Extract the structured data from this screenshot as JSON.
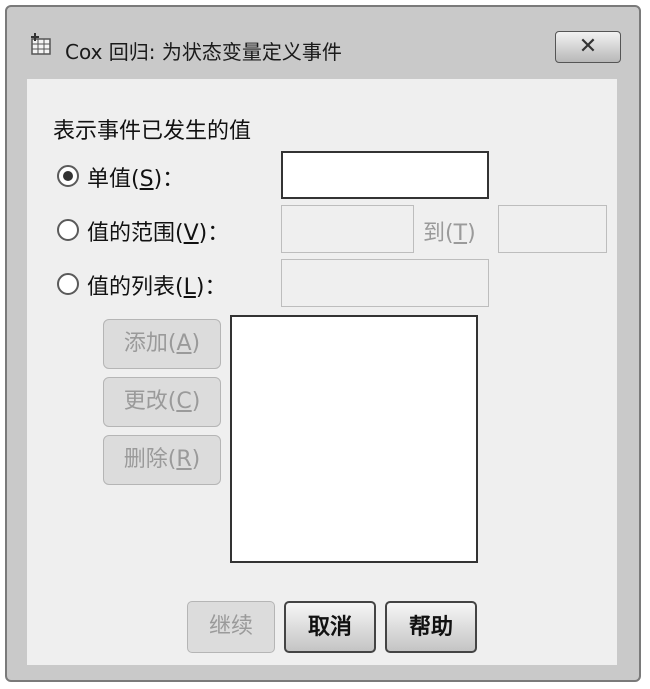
{
  "window": {
    "title": "Cox 回归: 为状态变量定义事件",
    "close_glyph": "✕",
    "app_icon": "data-table-icon"
  },
  "group_label": "表示事件已发生的值",
  "options": {
    "single": {
      "label": "单值",
      "mnemonic_open": "(",
      "mnemonic": "S",
      "mnemonic_close": ")",
      "colon": "：",
      "selected": true
    },
    "range": {
      "label": "值的范围",
      "mnemonic_open": "(",
      "mnemonic": "V",
      "mnemonic_close": ")",
      "colon": "：",
      "selected": false,
      "to_label": "到",
      "to_mnemonic_open": "(",
      "to_mnemonic": "T",
      "to_mnemonic_close": ")"
    },
    "list": {
      "label": "值的列表",
      "mnemonic_open": "(",
      "mnemonic": "L",
      "mnemonic_close": ")",
      "colon": "：",
      "selected": false
    }
  },
  "inputs": {
    "single_value": "",
    "range_from": "",
    "range_to": "",
    "list_value": ""
  },
  "list_buttons": {
    "add": {
      "label": "添加",
      "mnemonic": "A"
    },
    "change": {
      "label": "更改",
      "mnemonic": "C"
    },
    "remove": {
      "label": "删除",
      "mnemonic": "R"
    }
  },
  "footer": {
    "continue": "继续",
    "cancel": "取消",
    "help": "帮助"
  }
}
